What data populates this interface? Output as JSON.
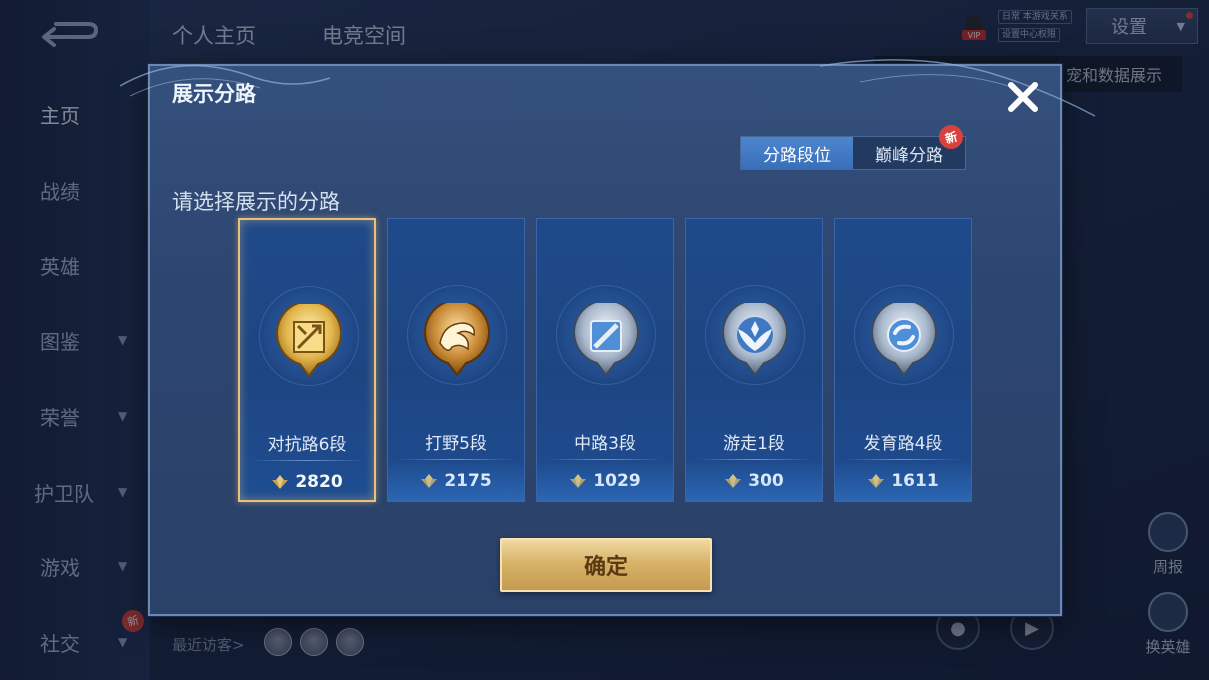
{
  "background": {
    "top_tabs": [
      "个人主页",
      "电竞空间"
    ],
    "sidebar": [
      {
        "label": "主页",
        "has_chevron": false
      },
      {
        "label": "战绩",
        "has_chevron": false
      },
      {
        "label": "英雄",
        "has_chevron": false
      },
      {
        "label": "图鉴",
        "has_chevron": true
      },
      {
        "label": "荣誉",
        "has_chevron": true
      },
      {
        "label": "护卫队",
        "has_chevron": true
      },
      {
        "label": "游戏",
        "has_chevron": true
      },
      {
        "label": "社交",
        "has_chevron": true
      }
    ],
    "sidebar_new_badge": "新",
    "vip_text_1": "日常 本游戏关系",
    "vip_text_2": "设置中心权限",
    "settings_label": "设置",
    "tooltip_text": "宠和数据展示",
    "right_buttons": [
      "周报",
      "换英雄"
    ],
    "recent_visitors_label": "最近访客>"
  },
  "modal": {
    "title": "展示分路",
    "close_icon": "close-icon",
    "tabs": [
      {
        "label": "分路段位",
        "active": true
      },
      {
        "label": "巅峰分路",
        "active": false,
        "badge": "新"
      }
    ],
    "prompt": "请选择展示的分路",
    "cards": [
      {
        "name": "对抗路6段",
        "score": "2820",
        "selected": true,
        "emblem": "gold-sword-emblem"
      },
      {
        "name": "打野5段",
        "score": "2175",
        "selected": false,
        "emblem": "gold-dragon-emblem"
      },
      {
        "name": "中路3段",
        "score": "1029",
        "selected": false,
        "emblem": "silver-staff-emblem"
      },
      {
        "name": "游走1段",
        "score": "300",
        "selected": false,
        "emblem": "silver-wings-emblem"
      },
      {
        "name": "发育路4段",
        "score": "1611",
        "selected": false,
        "emblem": "silver-bow-emblem"
      }
    ],
    "confirm_label": "确定"
  },
  "colors": {
    "modal_bg": "#2d4670",
    "card_bg": "#1f4a8a",
    "selected_border": "#e8c27a",
    "confirm_gold": "#d8b36a",
    "active_tab": "#3a6fb8",
    "badge_red": "#d8423c"
  }
}
